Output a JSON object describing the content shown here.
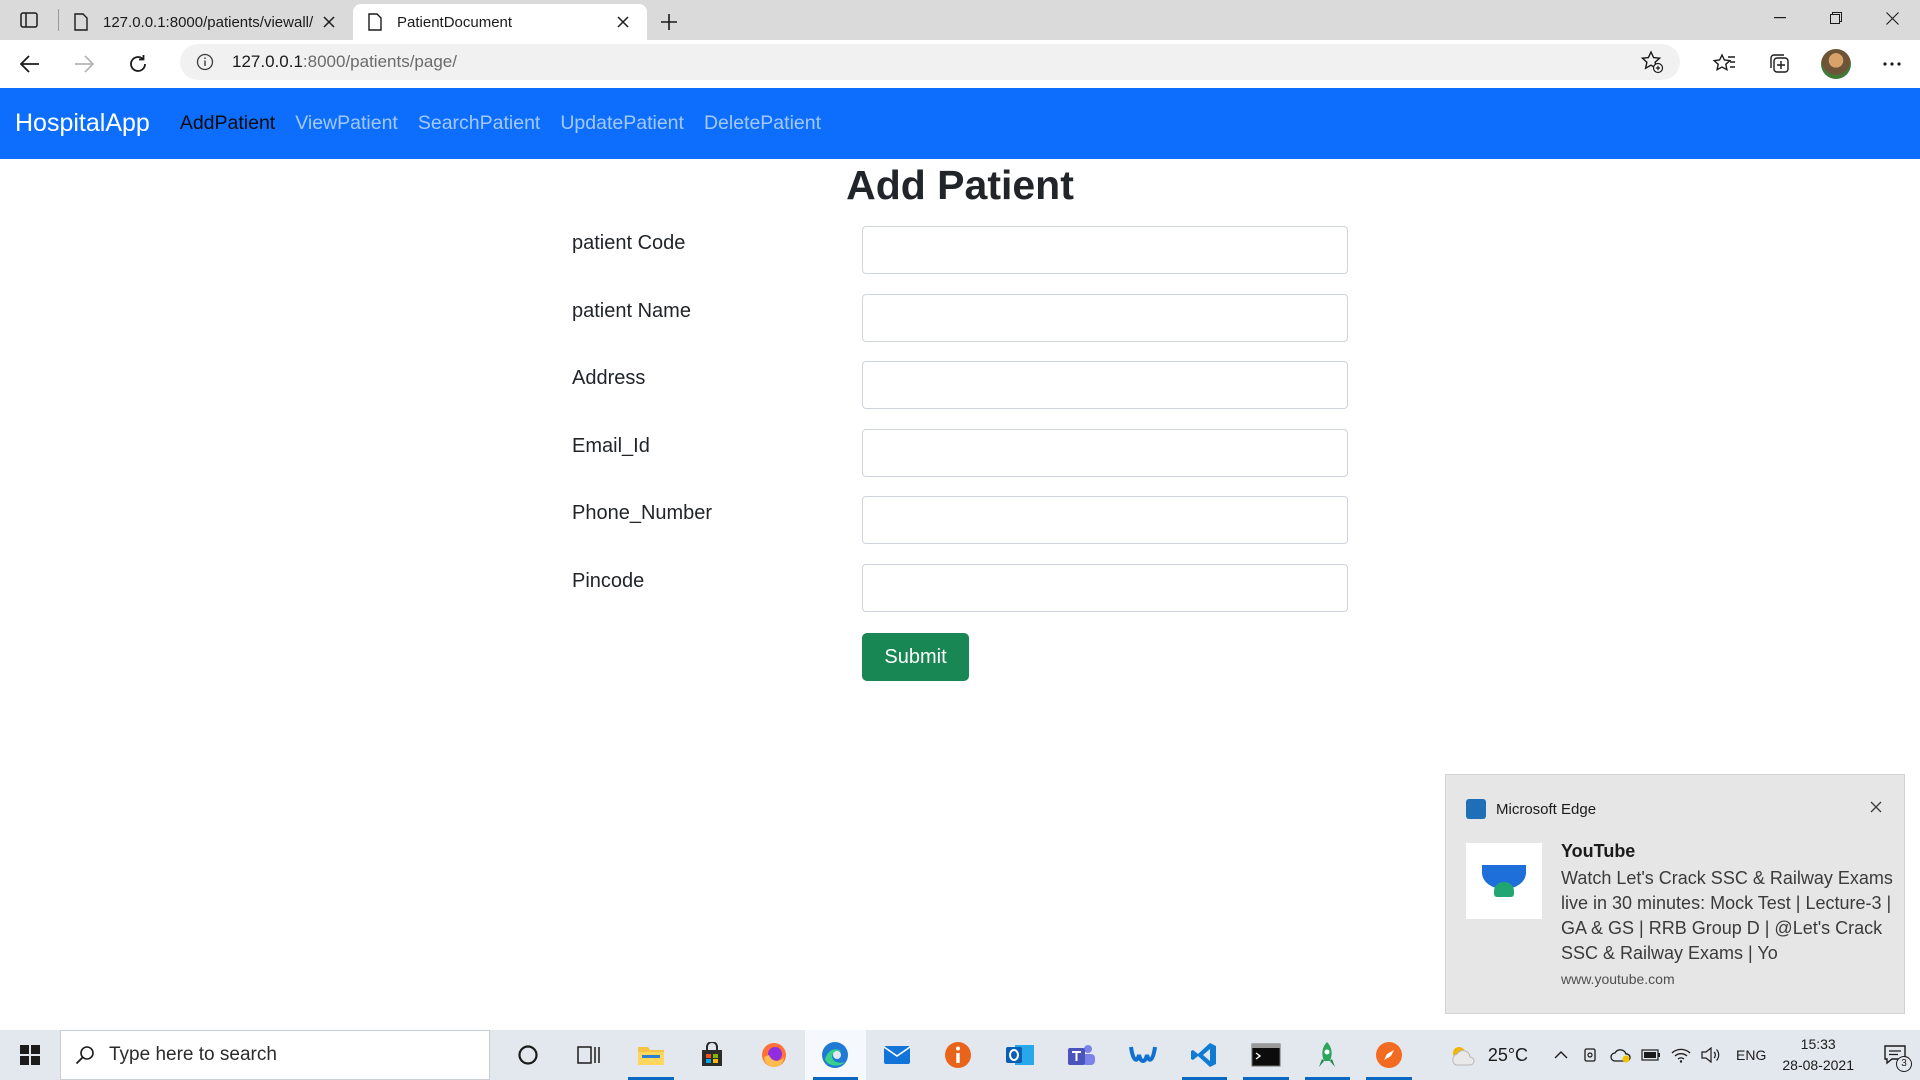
{
  "browser": {
    "tabs": [
      {
        "title": "127.0.0.1:8000/patients/viewall/",
        "active": false
      },
      {
        "title": "PatientDocument",
        "active": true
      }
    ],
    "address": {
      "host": "127.0.0.1",
      "path": ":8000/patients/page/"
    }
  },
  "navbar": {
    "brand": "HospitalApp",
    "links": [
      "AddPatient",
      "ViewPatient",
      "SearchPatient",
      "UpdatePatient",
      "DeletePatient"
    ],
    "active_link": "AddPatient",
    "color": "#0d6efd"
  },
  "form": {
    "title": "Add Patient",
    "fields": [
      {
        "label": "patient Code",
        "value": ""
      },
      {
        "label": "patient Name",
        "value": ""
      },
      {
        "label": "Address",
        "value": ""
      },
      {
        "label": "Email_Id",
        "value": ""
      },
      {
        "label": "Phone_Number",
        "value": ""
      },
      {
        "label": "Pincode",
        "value": ""
      }
    ],
    "submit_label": "Submit",
    "submit_color": "#198754"
  },
  "toast": {
    "app": "Microsoft Edge",
    "title": "YouTube",
    "body": "Watch Let's Crack SSC & Railway Exams live in 30 minutes: Mock Test | Lecture-3 | GA & GS | RRB Group D | @Let's Crack SSC & Railway Exams | Yo",
    "source": "www.youtube.com"
  },
  "taskbar": {
    "search_placeholder": "Type here to search",
    "apps": [
      "cortana-icon",
      "task-view-icon",
      "file-explorer-icon",
      "store-icon",
      "firefox-icon",
      "edge-icon",
      "mail-icon",
      "info-app-icon",
      "outlook-icon",
      "teams-icon",
      "webex-icon",
      "vscode-icon",
      "terminal-icon",
      "rocket-app-icon",
      "compass-app-icon"
    ],
    "weather": "25°C",
    "language": "ENG",
    "time": "15:33",
    "date": "28-08-2021",
    "notification_count": "3"
  }
}
